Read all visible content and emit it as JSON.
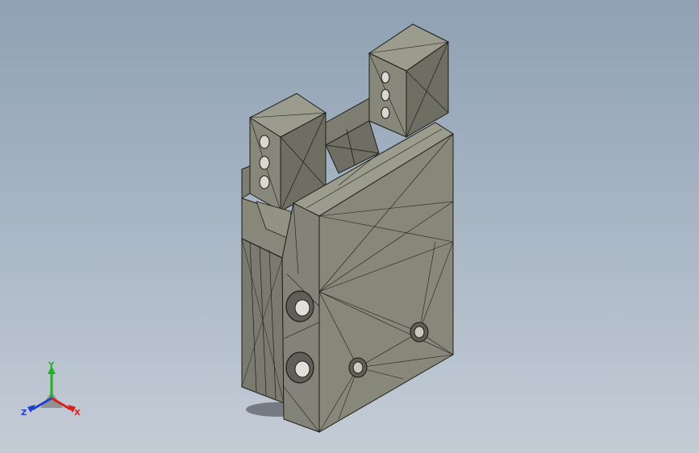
{
  "viewport": {
    "background_top": "#8fa1b3",
    "background_bottom": "#c4ccd6"
  },
  "model": {
    "face_color": "#87877a",
    "face_dark": "#6e6e63",
    "face_light": "#9c9c8e",
    "edge_color": "#1e1e1a"
  },
  "triad": {
    "x_label": "X",
    "y_label": "Y",
    "z_label": "Z",
    "x_color": "#d62020",
    "y_color": "#20b020",
    "z_color": "#2040d0"
  }
}
